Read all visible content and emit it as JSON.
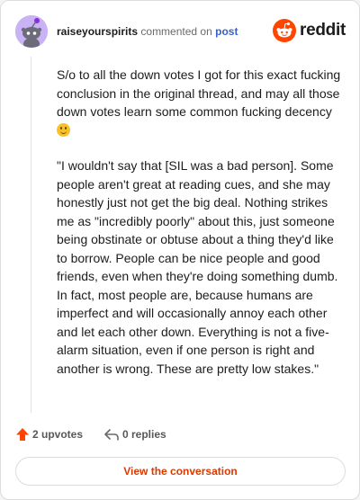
{
  "header": {
    "username": "raiseyourspirits",
    "action_text": "commented on",
    "post_link": "post",
    "logo_text": "reddit",
    "colors": {
      "brand": "#ff4500",
      "link": "#3a62c4"
    }
  },
  "comment": {
    "paragraph_1": "S/o to all the down votes I got for this exact fucking conclusion in the original thread, and may all those down votes learn some common fucking decency",
    "emoji": "slightly-smiling-face",
    "paragraph_2": "\"I wouldn't say that [SIL was a bad person]. Some people aren't great at reading cues, and she may honestly just not get the big deal. Nothing strikes me as \"incredibly poorly\" about this, just someone being obstinate or obtuse about a thing they'd like to borrow. People can be nice people and good friends, even when they're doing something dumb. In fact, most people are, because humans are imperfect and will occasionally annoy each other and let each other down. Everything is not a five-alarm situation, even if one person is right and another is wrong. These are pretty low stakes.\""
  },
  "footer": {
    "upvotes": "2 upvotes",
    "replies": "0 replies",
    "upvote_icon": "upvote-arrow-icon",
    "reply_icon": "reply-arrow-icon"
  },
  "cta": {
    "label": "View the conversation"
  }
}
